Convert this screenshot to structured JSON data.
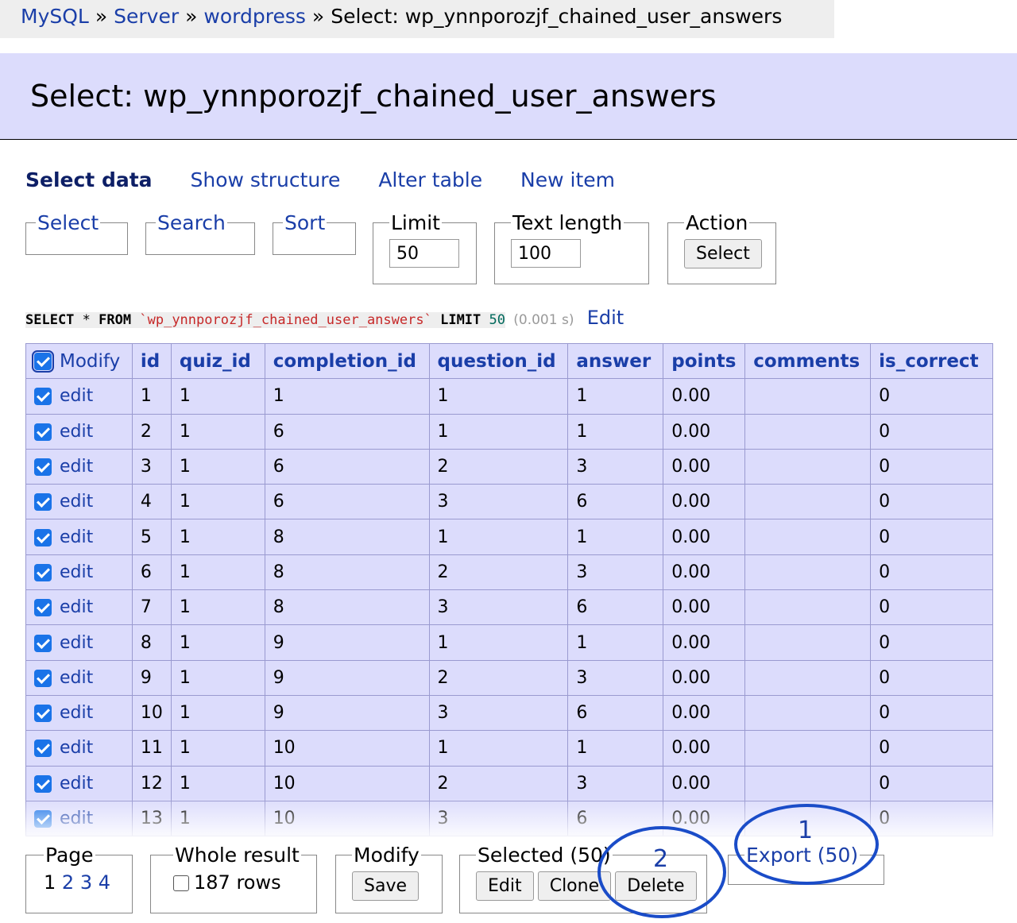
{
  "breadcrumb": {
    "items": [
      "MySQL",
      "Server",
      "wordpress"
    ],
    "sep": "»",
    "current": "Select: wp_ynnporozjf_chained_user_answers"
  },
  "header": {
    "title": "Select: wp_ynnporozjf_chained_user_answers"
  },
  "links": {
    "select_data": "Select data",
    "show_structure": "Show structure",
    "alter_table": "Alter table",
    "new_item": "New item"
  },
  "form": {
    "select_legend": "Select",
    "search_legend": "Search",
    "sort_legend": "Sort",
    "limit_legend": "Limit",
    "limit_value": "50",
    "text_length_legend": "Text length",
    "text_length_value": "100",
    "action_legend": "Action",
    "action_button": "Select"
  },
  "sql": {
    "select": "SELECT",
    "star": "*",
    "from": "FROM",
    "table": "`wp_ynnporozjf_chained_user_answers`",
    "limit": "LIMIT",
    "limit_num": "50",
    "time": "(0.001 s)",
    "edit": "Edit"
  },
  "table": {
    "modify_label": "Modify",
    "edit_label": "edit",
    "columns": [
      "id",
      "quiz_id",
      "completion_id",
      "question_id",
      "answer",
      "points",
      "comments",
      "is_correct"
    ],
    "rows": [
      [
        "1",
        "1",
        "1",
        "1",
        "1",
        "0.00",
        "",
        "0"
      ],
      [
        "2",
        "1",
        "6",
        "1",
        "1",
        "0.00",
        "",
        "0"
      ],
      [
        "3",
        "1",
        "6",
        "2",
        "3",
        "0.00",
        "",
        "0"
      ],
      [
        "4",
        "1",
        "6",
        "3",
        "6",
        "0.00",
        "",
        "0"
      ],
      [
        "5",
        "1",
        "8",
        "1",
        "1",
        "0.00",
        "",
        "0"
      ],
      [
        "6",
        "1",
        "8",
        "2",
        "3",
        "0.00",
        "",
        "0"
      ],
      [
        "7",
        "1",
        "8",
        "3",
        "6",
        "0.00",
        "",
        "0"
      ],
      [
        "8",
        "1",
        "9",
        "1",
        "1",
        "0.00",
        "",
        "0"
      ],
      [
        "9",
        "1",
        "9",
        "2",
        "3",
        "0.00",
        "",
        "0"
      ],
      [
        "10",
        "1",
        "9",
        "3",
        "6",
        "0.00",
        "",
        "0"
      ],
      [
        "11",
        "1",
        "10",
        "1",
        "1",
        "0.00",
        "",
        "0"
      ],
      [
        "12",
        "1",
        "10",
        "2",
        "3",
        "0.00",
        "",
        "0"
      ],
      [
        "13",
        "1",
        "10",
        "3",
        "6",
        "0.00",
        "",
        "0"
      ]
    ]
  },
  "footer": {
    "page_legend": "Page",
    "pages": [
      "1",
      "2",
      "3",
      "4"
    ],
    "whole_result_legend": "Whole result",
    "whole_result_label": "187 rows",
    "modify_legend": "Modify",
    "save_button": "Save",
    "selected_legend": "Selected (50)",
    "edit_button": "Edit",
    "clone_button": "Clone",
    "delete_button": "Delete",
    "export_legend": "Export (50)"
  },
  "annotations": {
    "one": "1",
    "two": "2",
    "color": "#1a4cc8"
  }
}
